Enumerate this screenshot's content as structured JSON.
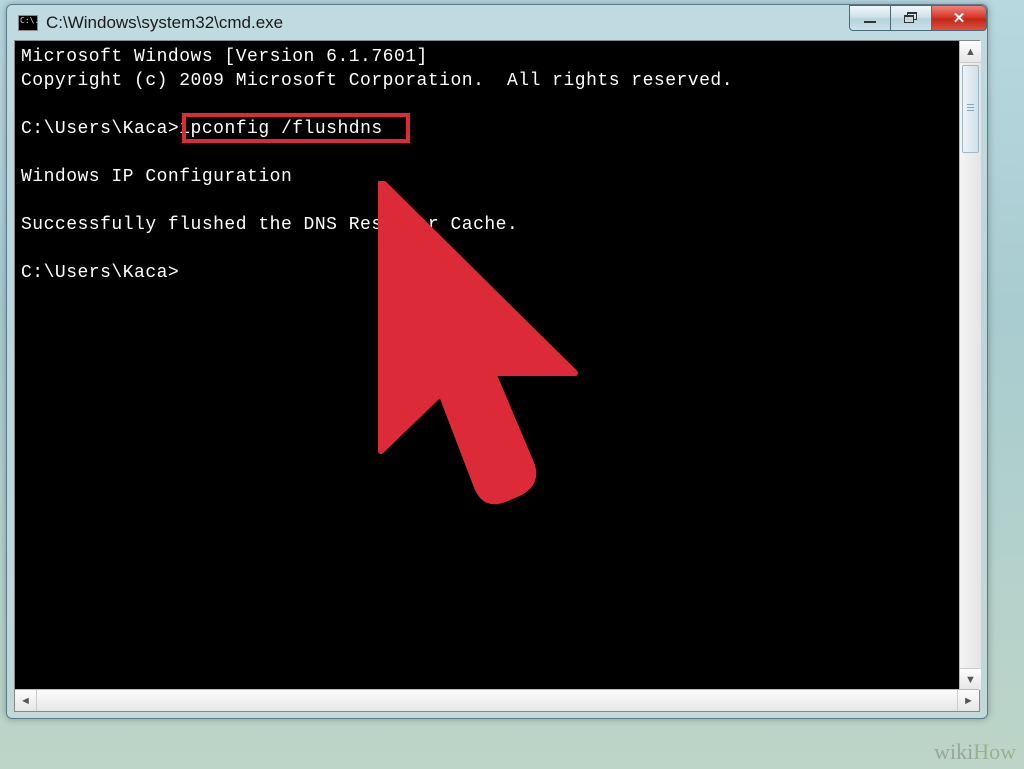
{
  "window": {
    "title": "C:\\Windows\\system32\\cmd.exe",
    "icon_label": "C:\\."
  },
  "console": {
    "line1": "Microsoft Windows [Version 6.1.7601]",
    "line2": "Copyright (c) 2009 Microsoft Corporation.  All rights reserved.",
    "blank1": "",
    "prompt1_prefix": "C:\\Users\\Kaca>",
    "prompt1_command": "ipconfig /flushdns",
    "blank2": "",
    "line_ipcfg": "Windows IP Configuration",
    "blank3": "",
    "line_success": "Successfully flushed the DNS Resolver Cache.",
    "blank4": "",
    "prompt2": "C:\\Users\\Kaca>"
  },
  "highlight": {
    "target": "ipconfig /flushdns"
  },
  "colors": {
    "cursor_fill": "#dc2a38",
    "highlight_border": "#dc2a38"
  },
  "watermark": {
    "wiki": "wiki",
    "how": "How"
  }
}
